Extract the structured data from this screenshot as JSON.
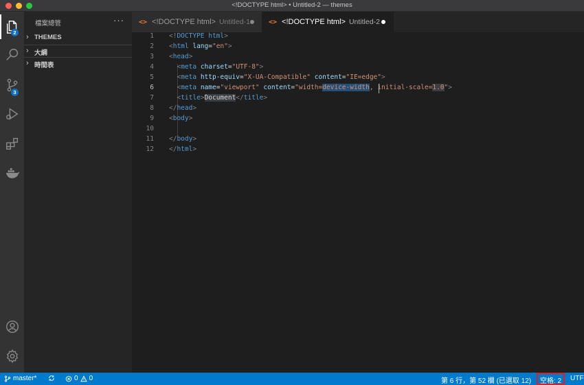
{
  "window": {
    "title": "<!DOCTYPE html> • Untitled-2 — themes"
  },
  "activity_bar": {
    "items": [
      {
        "icon": "files-icon",
        "badge": "2"
      },
      {
        "icon": "search-icon"
      },
      {
        "icon": "source-control-icon",
        "badge": "3"
      },
      {
        "icon": "run-debug-icon"
      },
      {
        "icon": "extensions-icon"
      },
      {
        "icon": "docker-icon"
      }
    ],
    "bottom": [
      {
        "icon": "account-icon"
      },
      {
        "icon": "gear-icon"
      }
    ]
  },
  "sidebar": {
    "title": "檔案總管",
    "more": "···",
    "sections": [
      {
        "label": "THEMES"
      },
      {
        "label": "大綱"
      },
      {
        "label": "時間表"
      }
    ]
  },
  "tabs": [
    {
      "icon_text": "<>",
      "label": "<!DOCTYPE html>",
      "sub": "Untitled-1",
      "active": false,
      "dirty": true
    },
    {
      "icon_text": "<>",
      "label": "<!DOCTYPE html>",
      "sub": "Untitled-2",
      "active": true,
      "dirty": true
    }
  ],
  "editor": {
    "line_numbers": [
      "1",
      "2",
      "3",
      "4",
      "5",
      "6",
      "7",
      "8",
      "9",
      "10",
      "11",
      "12"
    ],
    "current_line": "6",
    "lines": [
      {
        "t": "<!DOCTYPE html>"
      },
      {
        "t": "<html lang=\"en\">"
      },
      {
        "t": "<head>"
      },
      {
        "t": "  <meta charset=\"UTF-8\">"
      },
      {
        "t": "  <meta http-equiv=\"X-UA-Compatible\" content=\"IE=edge\">"
      },
      {
        "t": "  <meta name=\"viewport\" content=\"width=device-width, initial-scale=1.0\">"
      },
      {
        "t": "  <title>Document</title>"
      },
      {
        "t": "</head>"
      },
      {
        "t": "<body>"
      },
      {
        "t": "  "
      },
      {
        "t": "</body>"
      },
      {
        "t": "</html>"
      }
    ],
    "selection": "device-width"
  },
  "statusbar": {
    "branch": "master*",
    "errors": "0",
    "warnings": "0",
    "position": "第 6 行，第 52 欄 (已選取 12)",
    "indent": "空格: 2",
    "encoding": "UTF"
  },
  "colors": {
    "statusbar": "#007acc",
    "editor_bg": "#1e1e1e",
    "sidebar_bg": "#252526",
    "activity_bg": "#333333",
    "badge": "#0e70c0",
    "highlight_box": "#e02020"
  }
}
